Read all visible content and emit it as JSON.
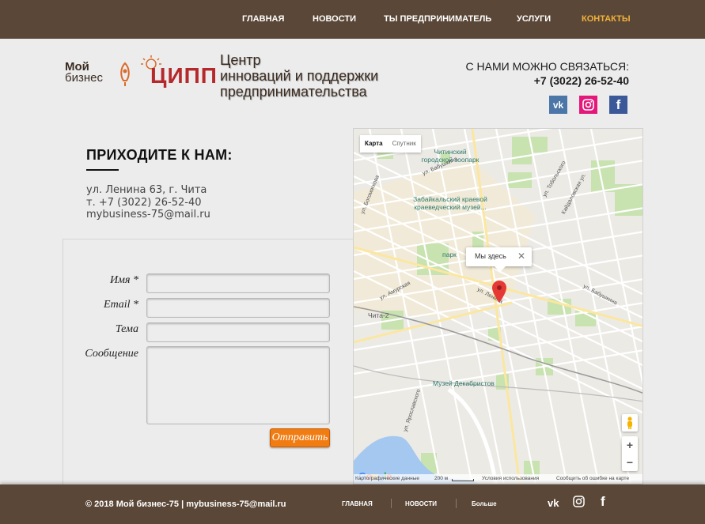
{
  "nav": {
    "items": [
      {
        "label": "ГЛАВНАЯ"
      },
      {
        "label": "НОВОСТИ"
      },
      {
        "label": "ТЫ ПРЕДПРИНИМАТЕЛЬ"
      },
      {
        "label": "УСЛУГИ"
      },
      {
        "label": "КОНТАКТЫ",
        "active": true
      }
    ],
    "active_color": "#f2b23a",
    "bg_color": "#5a4737"
  },
  "header": {
    "logo_line1": "Мой",
    "logo_line2": "бизнес",
    "logo_cipp": "ЦИПП",
    "tagline": [
      "Центр",
      "инноваций и поддержки",
      "предпринимательства"
    ],
    "contact_label": "С НАМИ МОЖНО СВЯЗАТЬСЯ:",
    "contact_phone": "+7 (3022) 26-52-40",
    "social": [
      {
        "icon": "vk-icon",
        "glyph": "vk",
        "color": "#4a76a8"
      },
      {
        "icon": "instagram-icon",
        "glyph": "◎",
        "color": "#e4187a"
      },
      {
        "icon": "facebook-icon",
        "glyph": "f",
        "color": "#3b5998"
      }
    ]
  },
  "visit": {
    "title": "ПРИХОДИТЕ К НАМ:",
    "address": "ул. Ленина 63, г. Чита",
    "phone": "т. +7 (3022) 26-52-40",
    "email": "mybusiness-75@mail.ru"
  },
  "form": {
    "name_label": "Имя *",
    "email_label": "Email *",
    "subject_label": "Тема",
    "message_label": "Сообщение",
    "name_value": "",
    "email_value": "",
    "subject_value": "",
    "message_value": "",
    "submit_label": "Отправить",
    "submit_color": "#f07c12"
  },
  "map": {
    "type_map": "Карта",
    "type_sat": "Спутник",
    "popup_text": "Мы здесь",
    "popup_close": "✕",
    "labels": {
      "zoo": "Читинский\nгородской зоопарк",
      "museum": "Забайкальский краевой\nкраеведческий музей...",
      "park": "парк",
      "decembrists": "Музей Декабристов",
      "chita2": "Чита-2"
    },
    "streets": {
      "bogomyagkova": "ул. Богомягкова",
      "babushkina_top": "ул. Бабушкина",
      "tobolskogo": "ул. Тобольского",
      "kaidalovskaya": "Кайдаловская ул.",
      "amurskaya": "ул. Амурская",
      "lenina": "ул. Ленина",
      "babushkina": "ул. Бабушкина",
      "yaroslavskogo": "ул. Ярославского"
    },
    "zoom_in": "+",
    "zoom_out": "−",
    "google": "Google",
    "footer_data": "Картографические данные",
    "footer_scale": "200 м",
    "footer_terms": "Условия использования",
    "footer_report": "Сообщить об ошибке на карте"
  },
  "footer": {
    "copyright": "© 2018 Мой бизнес-75 | mybusiness-75@mail.ru",
    "links": [
      {
        "label": "ГЛАВНАЯ"
      },
      {
        "label": "НОВОСТИ"
      },
      {
        "label": "Больше"
      }
    ],
    "social": [
      {
        "icon": "vk-icon",
        "glyph": "vk"
      },
      {
        "icon": "instagram-icon",
        "glyph": "◎"
      },
      {
        "icon": "facebook-icon",
        "glyph": "f"
      }
    ]
  }
}
